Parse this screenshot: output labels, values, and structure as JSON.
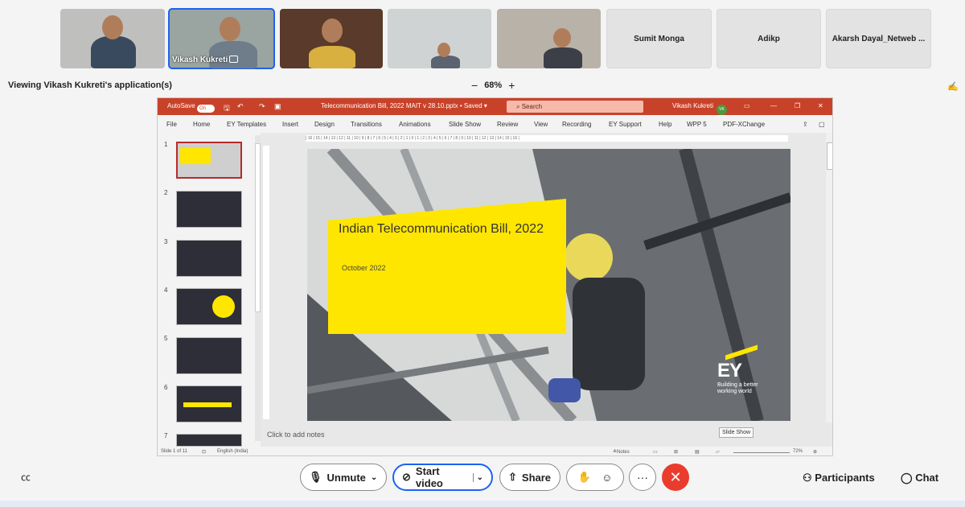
{
  "participants": {
    "tiles": [
      {
        "name": "",
        "video": true
      },
      {
        "name": "Vikash Kukreti",
        "video": true,
        "active": true
      },
      {
        "name": "",
        "video": true
      },
      {
        "name": "",
        "video": true
      },
      {
        "name": "",
        "video": true
      },
      {
        "name": "Sumit Monga",
        "video": false
      },
      {
        "name": "Adikp",
        "video": false
      },
      {
        "name": "Akarsh Dayal_Netweb ...",
        "video": false
      }
    ]
  },
  "share": {
    "viewing_text": "Viewing Vikash Kukreti's application(s)",
    "zoom_minus": "−",
    "zoom_level": "68%",
    "zoom_plus": "+"
  },
  "ppt": {
    "autosave_label": "AutoSave",
    "autosave_state": "On",
    "file_title": "Telecommunication Bill, 2022 MAIT v 28.10.pptx • Saved ▾",
    "search_placeholder": "Search",
    "user_name": "Vikash Kukreti",
    "user_initials": "VK",
    "menu": [
      "File",
      "Home",
      "EY Templates",
      "Insert",
      "Design",
      "Transitions",
      "Animations",
      "Slide Show",
      "Review",
      "View",
      "Recording",
      "EY Support",
      "Help",
      "WPP 5",
      "PDF-XChange"
    ],
    "thumb_numbers": [
      "1",
      "2",
      "3",
      "4",
      "5",
      "6",
      "7"
    ],
    "ruler_text": "| 16 | 15 | 14 | 13 | 12 | 11 | 10 | 9 | 8 | 7 | 6 | 5 | 4 | 3 | 2 | 1 | 0 | 1 | 2 | 3 | 4 | 5 | 6 | 7 | 8 | 9 | 10 | 11 | 12 | 13 | 14 | 15 | 16 |",
    "slide": {
      "title": "Indian Telecommunication Bill, 2022",
      "date": "October 2022",
      "logo": "EY",
      "tagline": "Building a better working world"
    },
    "notes_placeholder": "Click to add notes",
    "status_slide": "Slide 1 of 11",
    "status_language": "English (India)",
    "status_notes": "≜Notes",
    "status_zoom": "72%",
    "tooltip": "Slide Show"
  },
  "controls": {
    "unmute_label": "Unmute",
    "start_video_label": "Start video",
    "share_label": "Share",
    "participants_label": "Participants",
    "chat_label": "Chat"
  },
  "colors": {
    "accent_blue": "#1d62f0",
    "end_red": "#ea3c2e",
    "ppt_red": "#c8422a",
    "ey_yellow": "#ffe600"
  }
}
